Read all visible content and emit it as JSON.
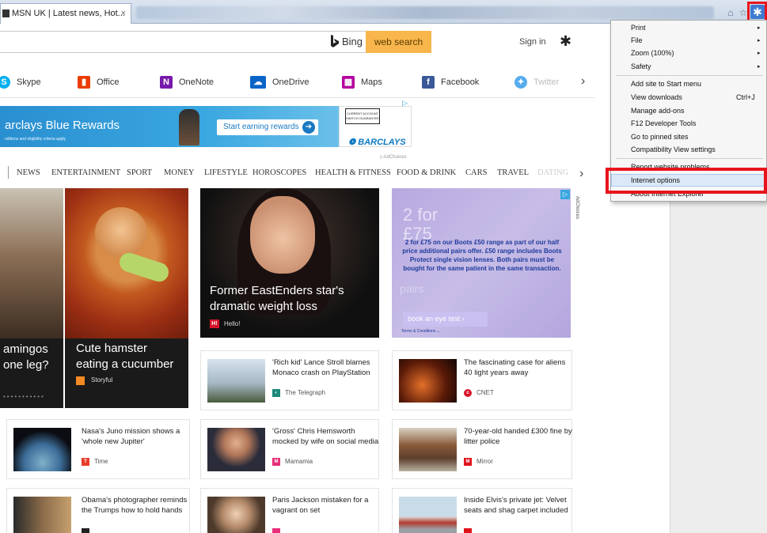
{
  "browser": {
    "tab_title": "MSN UK | Latest news, Hot...",
    "tab_close": "×",
    "home_icon": "⌂",
    "star_icon": "☆",
    "gear_icon": "✱"
  },
  "search": {
    "bing_label": "Bing",
    "button_label": "web search",
    "signin_label": "Sign in",
    "settings_icon": "✱"
  },
  "quick_links": [
    {
      "label": "Skype",
      "icon": "S",
      "color": "#00aff0"
    },
    {
      "label": "Office",
      "icon": "▮",
      "color": "#eb3c00"
    },
    {
      "label": "OneNote",
      "icon": "N",
      "color": "#7719aa"
    },
    {
      "label": "OneDrive",
      "icon": "☁",
      "color": "#0a64c8"
    },
    {
      "label": "Maps",
      "icon": "▦",
      "color": "#b4009e"
    },
    {
      "label": "Facebook",
      "icon": "f",
      "color": "#3b5998"
    },
    {
      "label": "Twitter",
      "icon": "✦",
      "color": "#55acee"
    }
  ],
  "quick_links_more": "›",
  "banner": {
    "title": "arclays Blue Rewards",
    "small_print": "nditions and eligibility criteria apply",
    "cta": "Start earning rewards",
    "cta_arrow": "➔",
    "badge_text": "CURRENT ACCOUNT SWITCH GUARANTEE",
    "brand": "❁ BARCLAYS",
    "adchoices": "▷AdChoices",
    "ad_info_icon": "▷"
  },
  "nav": {
    "items": [
      "NEWS",
      "ENTERTAINMENT",
      "SPORT",
      "MONEY",
      "LIFESTYLE",
      "HOROSCOPES",
      "HEALTH & FITNESS",
      "FOOD & DRINK",
      "CARS",
      "TRAVEL",
      "DATING"
    ],
    "more": "›"
  },
  "hero": {
    "left_title": "amingos\none leg?",
    "right_title": "Cute hamster\neating a cucumber",
    "source": "Storyful",
    "dots": "•••••••••••"
  },
  "story": {
    "title": "Former EastEnders star's dramatic weight loss",
    "source_icon": "H!",
    "source": "Hello!"
  },
  "ad_right": {
    "big": "2 for\n£75",
    "text": "2 for £75 on our Boots £50 range as part of our half price additional pairs offer. £50 range includes Boots Protect single vision lenses. Both pairs must be bought for the same patient in the same transaction.",
    "button": "book an eye test ›",
    "terms": "Terms & Conditions ⌄",
    "adchoices": "AdChoices",
    "pairs": "pairs"
  },
  "cards": [
    {
      "title": "'Rich kid' Lance Stroll blames Monaco crash on PlayStation",
      "source": "The Telegraph",
      "icon": "◐",
      "icon_color": "#1d8a7a"
    },
    {
      "title": "The fascinating case for aliens 40 light years away",
      "source": "CNET",
      "icon": "c",
      "icon_color": "#d8142a"
    },
    {
      "title": "Nasa's Juno mission shows a 'whole new Jupiter'",
      "source": "Time",
      "icon": "T",
      "icon_color": "#e63c2a"
    },
    {
      "title": "'Gross' Chris Hemsworth mocked by wife on social media",
      "source": "Mamamia",
      "icon": "M",
      "icon_color": "#e62e7a"
    },
    {
      "title": "70-year-old handed £300 fine by litter police",
      "source": "Mirror",
      "icon": "M",
      "icon_color": "#e0141c"
    },
    {
      "title": "Obama's photographer reminds the Trumps how to hold hands",
      "source": "",
      "icon": "",
      "icon_color": "#222"
    },
    {
      "title": "Paris Jackson mistaken for a vagrant on set",
      "source": "",
      "icon": "",
      "icon_color": "#e62e7a"
    },
    {
      "title": "Inside Elvis's private jet: Velvet seats and shag carpet included",
      "source": "",
      "icon": "",
      "icon_color": "#e0141c"
    }
  ],
  "menu": {
    "items": [
      {
        "label": "Print",
        "arrow": "▸"
      },
      {
        "label": "File",
        "arrow": "▸"
      },
      {
        "label": "Zoom (100%)",
        "arrow": "▸"
      },
      {
        "label": "Safety",
        "arrow": "▸"
      },
      {
        "label": "Add site to Start menu"
      },
      {
        "label": "View downloads",
        "shortcut": "Ctrl+J"
      },
      {
        "label": "Manage add-ons"
      },
      {
        "label": "F12 Developer Tools"
      },
      {
        "label": "Go to pinned sites"
      },
      {
        "label": "Compatibility View settings"
      },
      {
        "label": "Report website problems"
      },
      {
        "label": "Internet options"
      },
      {
        "label": "About Internet Explorer"
      }
    ]
  }
}
